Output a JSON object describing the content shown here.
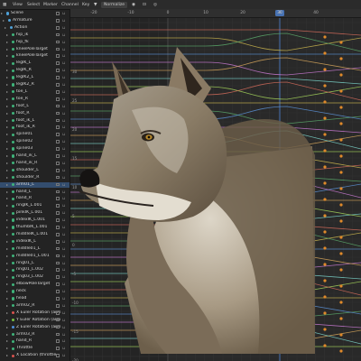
{
  "menubar": {
    "items": [
      "View",
      "Select",
      "Marker",
      "Channel",
      "Key"
    ],
    "normalize_label": "Normalize"
  },
  "timeline": {
    "tick_labels": [
      "-20",
      "-10",
      "0",
      "10",
      "20",
      "30",
      "40"
    ],
    "current_frame": "30",
    "value_labels": [
      "30",
      "25",
      "20",
      "15",
      "10",
      "5",
      "0",
      "-5",
      "-10",
      "-15",
      "-20"
    ]
  },
  "channels": [
    {
      "name": "Scene",
      "color": "#4fa1d8"
    },
    {
      "name": "Armature",
      "color": "#4fa1d8"
    },
    {
      "name": "Action",
      "color": "#4fa1d8"
    },
    {
      "name": "hip_ik",
      "color": "#3fb37a"
    },
    {
      "name": "hip_fk",
      "color": "#3fb37a"
    },
    {
      "name": "kneePoleTarget",
      "color": "#3fb37a"
    },
    {
      "name": "kneePoleTarget",
      "color": "#3fb37a"
    },
    {
      "name": "legIK_L",
      "color": "#3fb37a"
    },
    {
      "name": "legIK_R",
      "color": "#3fb37a"
    },
    {
      "name": "legIK2_L",
      "color": "#3fb37a"
    },
    {
      "name": "legIK2_R",
      "color": "#3fb37a"
    },
    {
      "name": "toe_L",
      "color": "#3fb37a"
    },
    {
      "name": "toe_R",
      "color": "#3fb37a"
    },
    {
      "name": "foot_L",
      "color": "#3fb37a"
    },
    {
      "name": "foot_R",
      "color": "#3fb37a"
    },
    {
      "name": "foot_ik_L",
      "color": "#3fb37a"
    },
    {
      "name": "foot_ik_R",
      "color": "#3fb37a"
    },
    {
      "name": "spine01",
      "color": "#3fb37a"
    },
    {
      "name": "spine02",
      "color": "#3fb37a"
    },
    {
      "name": "spine03",
      "color": "#3fb37a"
    },
    {
      "name": "hand_ik_L",
      "color": "#3fb37a"
    },
    {
      "name": "hand_ik_R",
      "color": "#3fb37a"
    },
    {
      "name": "shoulder_L",
      "color": "#3fb37a"
    },
    {
      "name": "shoulder_R",
      "color": "#3fb37a"
    },
    {
      "name": "arm01_L",
      "color": "#3fb37a"
    },
    {
      "name": "hand_L",
      "color": "#3fb37a"
    },
    {
      "name": "hand_R",
      "color": "#3fb37a"
    },
    {
      "name": "ringIK_L.001",
      "color": "#3fb37a"
    },
    {
      "name": "pinkIK_L.001",
      "color": "#3fb37a"
    },
    {
      "name": "indexIK_L.001",
      "color": "#3fb37a"
    },
    {
      "name": "thumbIK_L.001",
      "color": "#3fb37a"
    },
    {
      "name": "middleIK_L.001",
      "color": "#3fb37a"
    },
    {
      "name": "indexIK_L",
      "color": "#3fb37a"
    },
    {
      "name": "middle01_L",
      "color": "#3fb37a"
    },
    {
      "name": "middle01_L.001",
      "color": "#3fb37a"
    },
    {
      "name": "ring01_L",
      "color": "#3fb37a"
    },
    {
      "name": "ring01_L.002",
      "color": "#3fb37a"
    },
    {
      "name": "ring03_L.002",
      "color": "#3fb37a"
    },
    {
      "name": "elbowPoleTarget",
      "color": "#3fb37a"
    },
    {
      "name": "neck",
      "color": "#3fb37a"
    },
    {
      "name": "head",
      "color": "#3fb37a"
    },
    {
      "name": "arm02_R",
      "color": "#3fb37a"
    },
    {
      "name": "X Euler Rotation (arm",
      "color": "#d9534f"
    },
    {
      "name": "Y Euler Rotation (arm",
      "color": "#76c043"
    },
    {
      "name": "Z Euler Rotation (arm",
      "color": "#4f8fd9"
    },
    {
      "name": "arm03_R",
      "color": "#3fb37a"
    },
    {
      "name": "hand_R",
      "color": "#3fb37a"
    },
    {
      "name": "Throttle",
      "color": "#3fb37a"
    },
    {
      "name": "X Location (throttle",
      "color": "#d9534f"
    }
  ]
}
